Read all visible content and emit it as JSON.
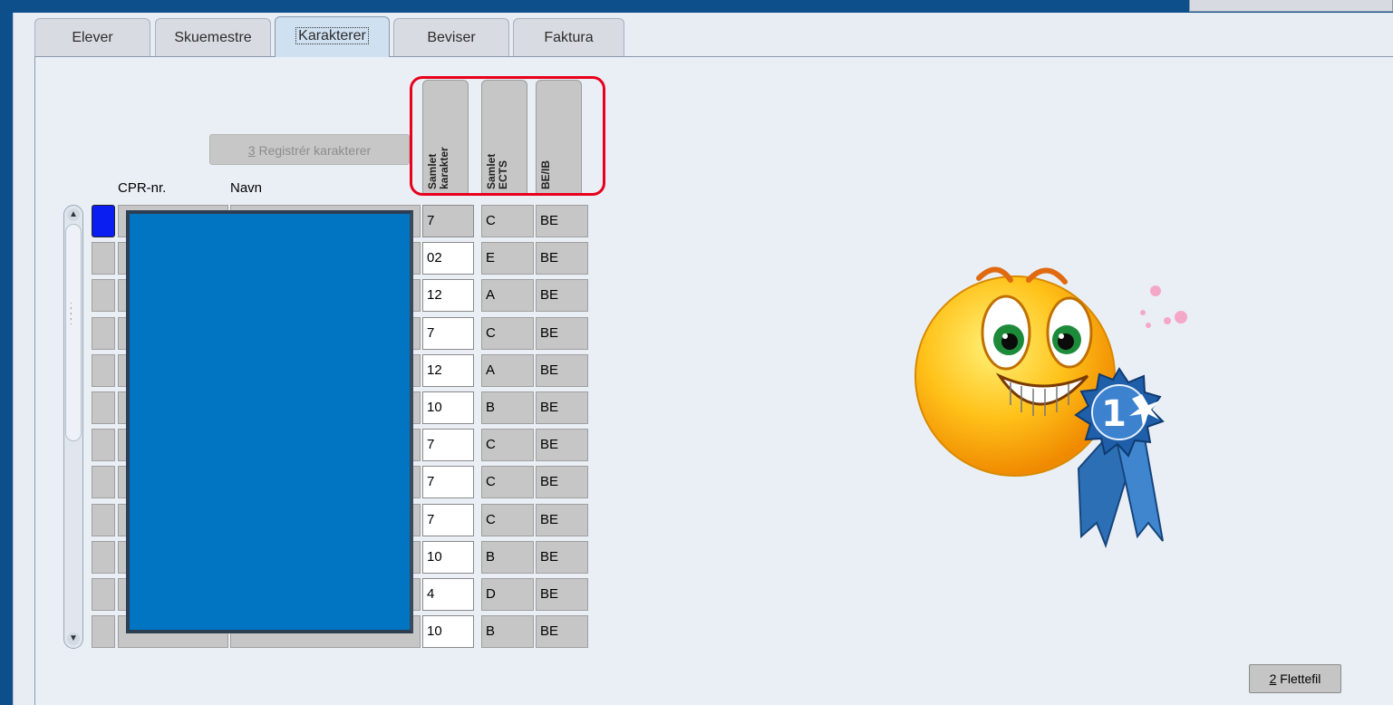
{
  "tabs": [
    {
      "label": "Elever",
      "active": false
    },
    {
      "label": "Skuemestre",
      "active": false
    },
    {
      "label": "Karakterer",
      "active": true
    },
    {
      "label": "Beviser",
      "active": false
    },
    {
      "label": "Faktura",
      "active": false
    }
  ],
  "register_button": {
    "accel": "3",
    "label": " Registrér karakterer"
  },
  "columns": {
    "cpr": "CPR-nr.",
    "navn": "Navn",
    "samlet_karakter_line1": "Samlet",
    "samlet_karakter_line2": "karakter",
    "samlet_ects_line1": "Samlet",
    "samlet_ects_line2": "ECTS",
    "be_ib": "BE/IB"
  },
  "rows": [
    {
      "karakter": "7",
      "ects": "C",
      "beib": "BE"
    },
    {
      "karakter": "02",
      "ects": "E",
      "beib": "BE"
    },
    {
      "karakter": "12",
      "ects": "A",
      "beib": "BE"
    },
    {
      "karakter": "7",
      "ects": "C",
      "beib": "BE"
    },
    {
      "karakter": "12",
      "ects": "A",
      "beib": "BE"
    },
    {
      "karakter": "10",
      "ects": "B",
      "beib": "BE"
    },
    {
      "karakter": "7",
      "ects": "C",
      "beib": "BE"
    },
    {
      "karakter": "7",
      "ects": "C",
      "beib": "BE"
    },
    {
      "karakter": "7",
      "ects": "C",
      "beib": "BE"
    },
    {
      "karakter": "10",
      "ects": "B",
      "beib": "BE"
    },
    {
      "karakter": "4",
      "ects": "D",
      "beib": "BE"
    },
    {
      "karakter": "10",
      "ects": "B",
      "beib": "BE"
    }
  ],
  "flettefil_button": {
    "accel": "2",
    "label": " Flettefil"
  },
  "medal": {
    "number": "1"
  },
  "colors": {
    "highlight": "#e8001c",
    "mask": "#0174c2",
    "selected": "#0a1ef2"
  }
}
